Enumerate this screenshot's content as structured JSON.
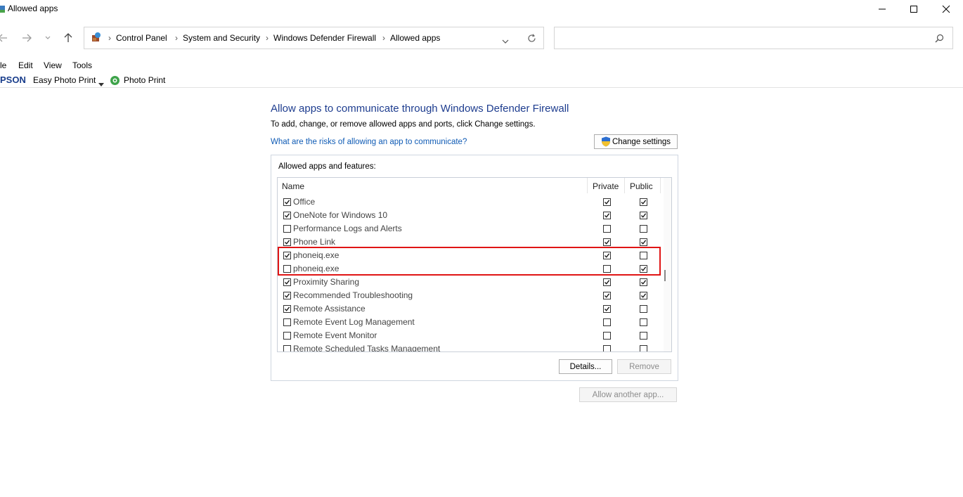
{
  "window": {
    "title": "Allowed apps"
  },
  "address": {
    "crumbs": [
      "Control Panel",
      "System and Security",
      "Windows Defender Firewall",
      "Allowed apps"
    ]
  },
  "search": {
    "placeholder": ""
  },
  "menu": {
    "items": [
      "le",
      "Edit",
      "View",
      "Tools"
    ]
  },
  "toolbar": {
    "brand": "PSON",
    "easy_photo_print": "Easy Photo Print",
    "photo_print": "Photo Print"
  },
  "main": {
    "heading": "Allow apps to communicate through Windows Defender Firewall",
    "subtitle": "To add, change, or remove allowed apps and ports, click Change settings.",
    "risk_link": "What are the risks of allowing an app to communicate?",
    "change_settings": "Change settings",
    "group_label": "Allowed apps and features:",
    "columns": {
      "name": "Name",
      "private": "Private",
      "public": "Public"
    },
    "rows": [
      {
        "name": "Office",
        "enabled": true,
        "private": true,
        "public": true
      },
      {
        "name": "OneNote for Windows 10",
        "enabled": true,
        "private": true,
        "public": true
      },
      {
        "name": "Performance Logs and Alerts",
        "enabled": false,
        "private": false,
        "public": false
      },
      {
        "name": "Phone Link",
        "enabled": true,
        "private": true,
        "public": true
      },
      {
        "name": "phoneiq.exe",
        "enabled": true,
        "private": true,
        "public": false
      },
      {
        "name": "phoneiq.exe",
        "enabled": false,
        "private": false,
        "public": true
      },
      {
        "name": "Proximity Sharing",
        "enabled": true,
        "private": true,
        "public": true
      },
      {
        "name": "Recommended Troubleshooting",
        "enabled": true,
        "private": true,
        "public": true
      },
      {
        "name": "Remote Assistance",
        "enabled": true,
        "private": true,
        "public": false
      },
      {
        "name": "Remote Event Log Management",
        "enabled": false,
        "private": false,
        "public": false
      },
      {
        "name": "Remote Event Monitor",
        "enabled": false,
        "private": false,
        "public": false
      },
      {
        "name": "Remote Scheduled Tasks Management",
        "enabled": false,
        "private": false,
        "public": false
      }
    ],
    "details_button": "Details...",
    "remove_button": "Remove",
    "allow_another_button": "Allow another app..."
  },
  "colors": {
    "heading": "#1e3d8f",
    "link": "#0f5bb5",
    "highlight": "#e01515"
  }
}
